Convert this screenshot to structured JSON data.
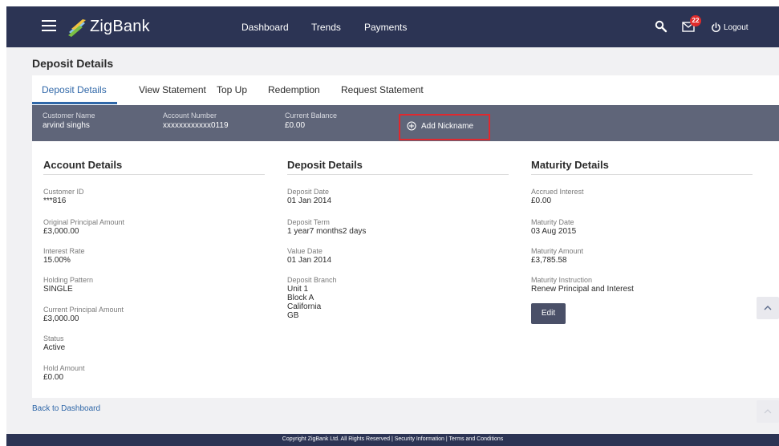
{
  "header": {
    "app_name": "ZigBank",
    "nav": [
      "Dashboard",
      "Trends",
      "Payments"
    ],
    "mail_count": "22",
    "logout_label": "Logout",
    "icons": {
      "menu": "hamburger-icon",
      "logo": "zigbank-logo",
      "search": "search-icon",
      "mail": "mail-icon",
      "logout": "power-icon"
    },
    "colors": {
      "bar": "#2c3454",
      "badge": "#e02b2b",
      "logo_accent": "#8ac4ea"
    }
  },
  "page_title": "Deposit Details",
  "tabs": {
    "items": [
      "Deposit Details",
      "View Statement",
      "Top Up",
      "Redemption",
      "Request Statement"
    ],
    "active": "Deposit Details",
    "accent": "#2f67a8"
  },
  "summary": {
    "customer_name_label": "Customer Name",
    "customer_name": "arvind singhs",
    "account_number_label": "Account Number",
    "account_number": "xxxxxxxxxxxx0119",
    "current_balance_label": "Current Balance",
    "current_balance": "£0.00",
    "add_nickname": "Add Nickname",
    "add_nickname_icon": "plus-circle-icon"
  },
  "account_details": {
    "title": "Account Details",
    "fields": [
      {
        "label": "Customer ID",
        "value": "***816"
      },
      {
        "label": "Original Principal Amount",
        "value": "£3,000.00"
      },
      {
        "label": "Interest Rate",
        "value": "15.00%"
      },
      {
        "label": "Holding Pattern",
        "value": "SINGLE"
      },
      {
        "label": "Current Principal Amount",
        "value": "£3,000.00"
      },
      {
        "label": "Status",
        "value": "Active"
      },
      {
        "label": "Hold Amount",
        "value": "£0.00"
      }
    ]
  },
  "deposit_details": {
    "title": "Deposit Details",
    "fields": [
      {
        "label": "Deposit Date",
        "value": "01 Jan 2014"
      },
      {
        "label": "Deposit Term",
        "value": "1 year7 months2 days"
      },
      {
        "label": "Value Date",
        "value": "01 Jan 2014"
      }
    ],
    "branch_label": "Deposit Branch",
    "branch_lines": [
      "Unit 1",
      "Block A",
      "California",
      "GB"
    ]
  },
  "maturity_details": {
    "title": "Maturity Details",
    "fields": [
      {
        "label": "Accrued Interest",
        "value": "£0.00"
      },
      {
        "label": "Maturity Date",
        "value": "03 Aug 2015"
      },
      {
        "label": "Maturity Amount",
        "value": "£3,785.58"
      },
      {
        "label": "Maturity Instruction",
        "value": "Renew Principal and Interest"
      }
    ],
    "edit_label": "Edit"
  },
  "back_link": "Back to Dashboard",
  "footer": "Copyright ZigBank Ltd. All Rights Reserved | Security Information | Terms and Conditions",
  "scroll_icon": "chevron-up-icon"
}
